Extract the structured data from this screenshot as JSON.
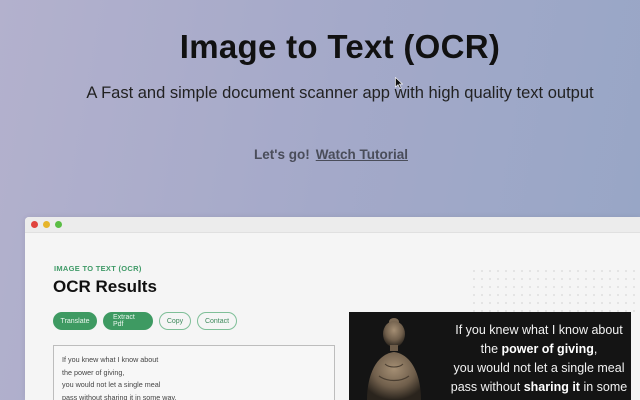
{
  "hero": {
    "title": "Image to Text (OCR)",
    "subtitle": "A Fast and simple document scanner app with high quality text output",
    "cta_lead": "Let's go!",
    "cta_link": "Watch Tutorial"
  },
  "app": {
    "eyebrow": "IMAGE TO TEXT (OCR)",
    "title": "OCR Results",
    "buttons": {
      "translate": "Translate",
      "extract_pdf": "Extract Pdf",
      "copy": "Copy",
      "contact": "Contact"
    },
    "ocr_text": {
      "line1": "If you knew what I know about",
      "line2": "the power of giving,",
      "line3": "you would not let a single meal",
      "line4": "pass without sharing it in some way."
    },
    "preview_quote": {
      "l1": "If you knew what I know about",
      "l2_pre": "the ",
      "l2_bold": "power of giving",
      "l2_post": ",",
      "l3": "you would not let a single meal",
      "l4_pre": "pass without ",
      "l4_bold": "sharing it",
      "l4_post": " in some way."
    }
  },
  "colors": {
    "accent_green": "#3e9a62",
    "window_dot_red": "#e0443e",
    "window_dot_yellow": "#e6b52c",
    "window_dot_green": "#5bbd45"
  },
  "icons": {
    "cursor": "mouse-cursor-icon"
  }
}
